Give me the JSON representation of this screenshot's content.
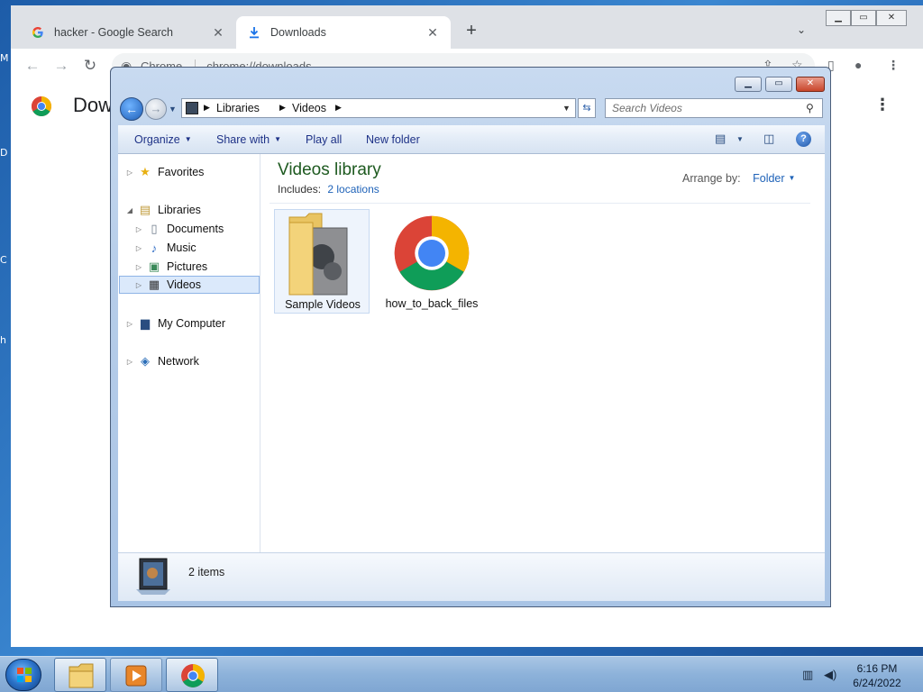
{
  "desktop": {
    "edge_letters": [
      "M",
      "D",
      "C",
      "h"
    ]
  },
  "chrome": {
    "tabs": [
      {
        "label": "hacker - Google Search",
        "icon": "google-g-icon",
        "active": false
      },
      {
        "label": "Downloads",
        "icon": "download-icon",
        "active": true
      }
    ],
    "omnibox": {
      "site_label": "Chrome",
      "url": "chrome://downloads"
    },
    "page_title": "Downloads"
  },
  "explorer": {
    "breadcrumb": [
      "Libraries",
      "Videos"
    ],
    "search_placeholder": "Search Videos",
    "commands": {
      "organize": "Organize",
      "share_with": "Share with",
      "play_all": "Play all",
      "new_folder": "New folder"
    },
    "nav": {
      "favorites": "Favorites",
      "libraries": "Libraries",
      "documents": "Documents",
      "music": "Music",
      "pictures": "Pictures",
      "videos": "Videos",
      "my_computer": "My Computer",
      "network": "Network"
    },
    "library": {
      "title": "Videos library",
      "includes_label": "Includes:",
      "locations_link": "2 locations",
      "arrange_label": "Arrange by:",
      "arrange_value": "Folder"
    },
    "items": [
      {
        "label": "Sample Videos",
        "icon": "folder-icon"
      },
      {
        "label": "how_to_back_files",
        "icon": "chrome-icon"
      }
    ],
    "details": {
      "count": "2 items"
    }
  },
  "taskbar": {
    "time": "6:16 PM",
    "date": "6/24/2022"
  },
  "colors": {
    "library_title": "#1e5a20",
    "link": "#1e62b8",
    "command_text": "#1e3287"
  }
}
